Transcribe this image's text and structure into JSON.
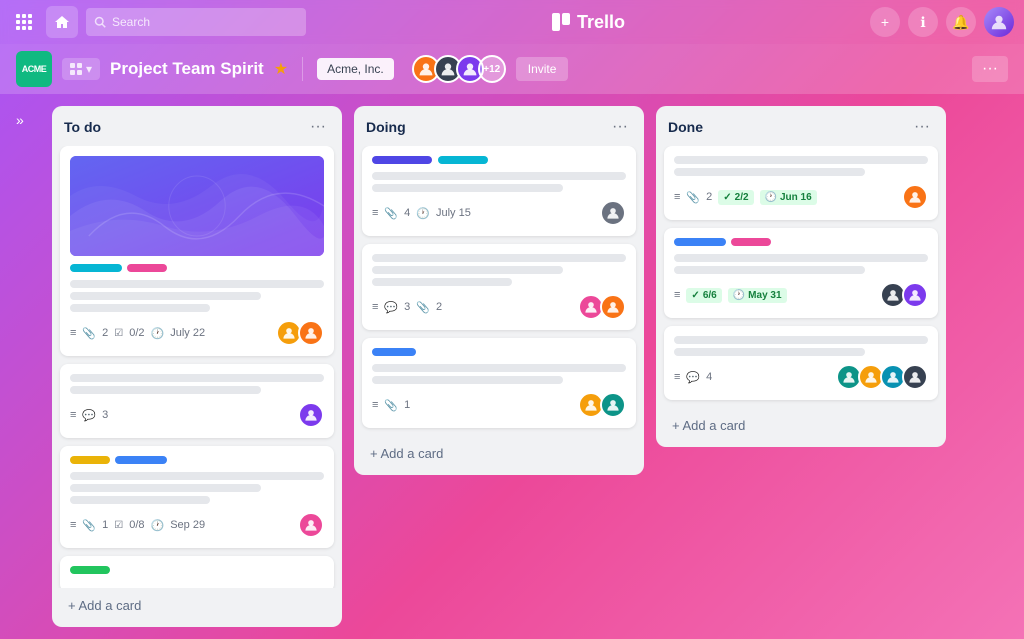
{
  "topNav": {
    "searchPlaceholder": "Search",
    "logoText": "Trello",
    "logoIcon": "🗂"
  },
  "boardHeader": {
    "logoText": "ACME",
    "boardName": "Project Team Spirit",
    "workspaceName": "Acme, Inc.",
    "memberCount": "+12",
    "inviteLabel": "Invite",
    "moreLabel": "···"
  },
  "sidebarToggle": "»",
  "columns": [
    {
      "id": "todo",
      "title": "To do",
      "cards": [
        {
          "id": "c1",
          "hasImage": true,
          "tags": [
            {
              "color": "cyan"
            },
            {
              "color": "pink"
            }
          ],
          "lines": [
            "full",
            "med",
            "short"
          ],
          "meta": {
            "attachments": "2",
            "checklist": "0/2",
            "date": "July 22"
          },
          "avatars": [
            "yellow",
            "orange"
          ]
        },
        {
          "id": "c2",
          "hasImage": false,
          "tags": [],
          "lines": [
            "full",
            "med"
          ],
          "meta": {
            "comments": "3"
          },
          "avatars": [
            "purple"
          ]
        },
        {
          "id": "c3",
          "hasImage": false,
          "tags": [
            {
              "color": "yellow"
            },
            {
              "color": "blue"
            }
          ],
          "lines": [
            "full",
            "med",
            "short"
          ],
          "meta": {
            "attachments": "1",
            "checklist": "0/8",
            "date": "Sep 29"
          },
          "avatars": [
            "pink"
          ]
        },
        {
          "id": "c4",
          "hasImage": false,
          "tags": [
            {
              "color": "green-sm"
            }
          ],
          "lines": [],
          "meta": {},
          "avatars": []
        }
      ],
      "addLabel": "+ Add a card"
    },
    {
      "id": "doing",
      "title": "Doing",
      "cards": [
        {
          "id": "d1",
          "hasDoingBars": true,
          "lines": [
            "full",
            "med"
          ],
          "meta": {
            "attachments": "4",
            "date": "July 15"
          },
          "avatars": [
            "gray"
          ]
        },
        {
          "id": "d2",
          "hasImage": false,
          "lines": [
            "full",
            "med",
            "short"
          ],
          "meta": {
            "comments": "3",
            "attachments": "2"
          },
          "avatars": [
            "pink",
            "orange"
          ]
        },
        {
          "id": "d3",
          "hasImage": false,
          "tags": [
            {
              "color": "blue"
            }
          ],
          "lines": [
            "full",
            "med"
          ],
          "meta": {
            "attachments": "1"
          },
          "avatars": [
            "yellow",
            "teal"
          ]
        }
      ],
      "addLabel": "+ Add a card"
    },
    {
      "id": "done",
      "title": "Done",
      "cards": [
        {
          "id": "dn1",
          "hasImage": false,
          "lines": [
            "full",
            "med"
          ],
          "meta": {
            "attachments": "2",
            "checklist_done": "2/2",
            "date_done": "Jun 16"
          },
          "avatars": [
            "orange"
          ]
        },
        {
          "id": "dn2",
          "hasImage": false,
          "tags": [
            {
              "color": "blue"
            },
            {
              "color": "pink"
            }
          ],
          "lines": [
            "full",
            "med"
          ],
          "meta": {
            "checklist_done": "6/6",
            "date_done": "May 31"
          },
          "avatars": [
            "dark",
            "purple"
          ]
        },
        {
          "id": "dn3",
          "hasImage": false,
          "lines": [
            "full",
            "med"
          ],
          "meta": {
            "comments": "4"
          },
          "avatars": [
            "teal",
            "yellow",
            "cyan",
            "dark"
          ]
        }
      ],
      "addLabel": "+ Add a card"
    }
  ]
}
